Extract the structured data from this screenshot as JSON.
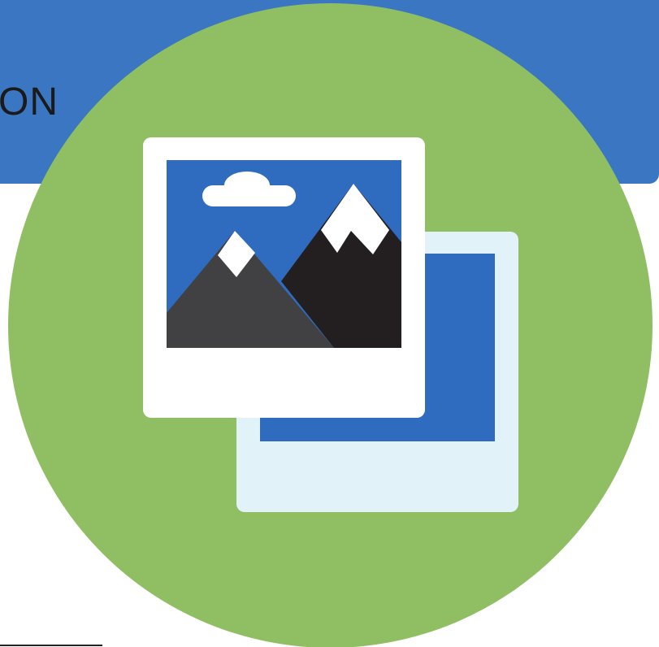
{
  "header": {
    "text": "ON"
  },
  "colors": {
    "header_blue": "#3A76C1",
    "circle_green": "#8FBF62",
    "photo_blue": "#2F6CBF",
    "back_frame": "#E1F2F8",
    "front_frame": "#FFFFFF",
    "mountain_dark": "#231F20",
    "mountain_grey": "#414143",
    "snow": "#FFFFFF",
    "cloud": "#FFFFFF"
  },
  "icon": {
    "name": "photo-gallery-icon"
  }
}
